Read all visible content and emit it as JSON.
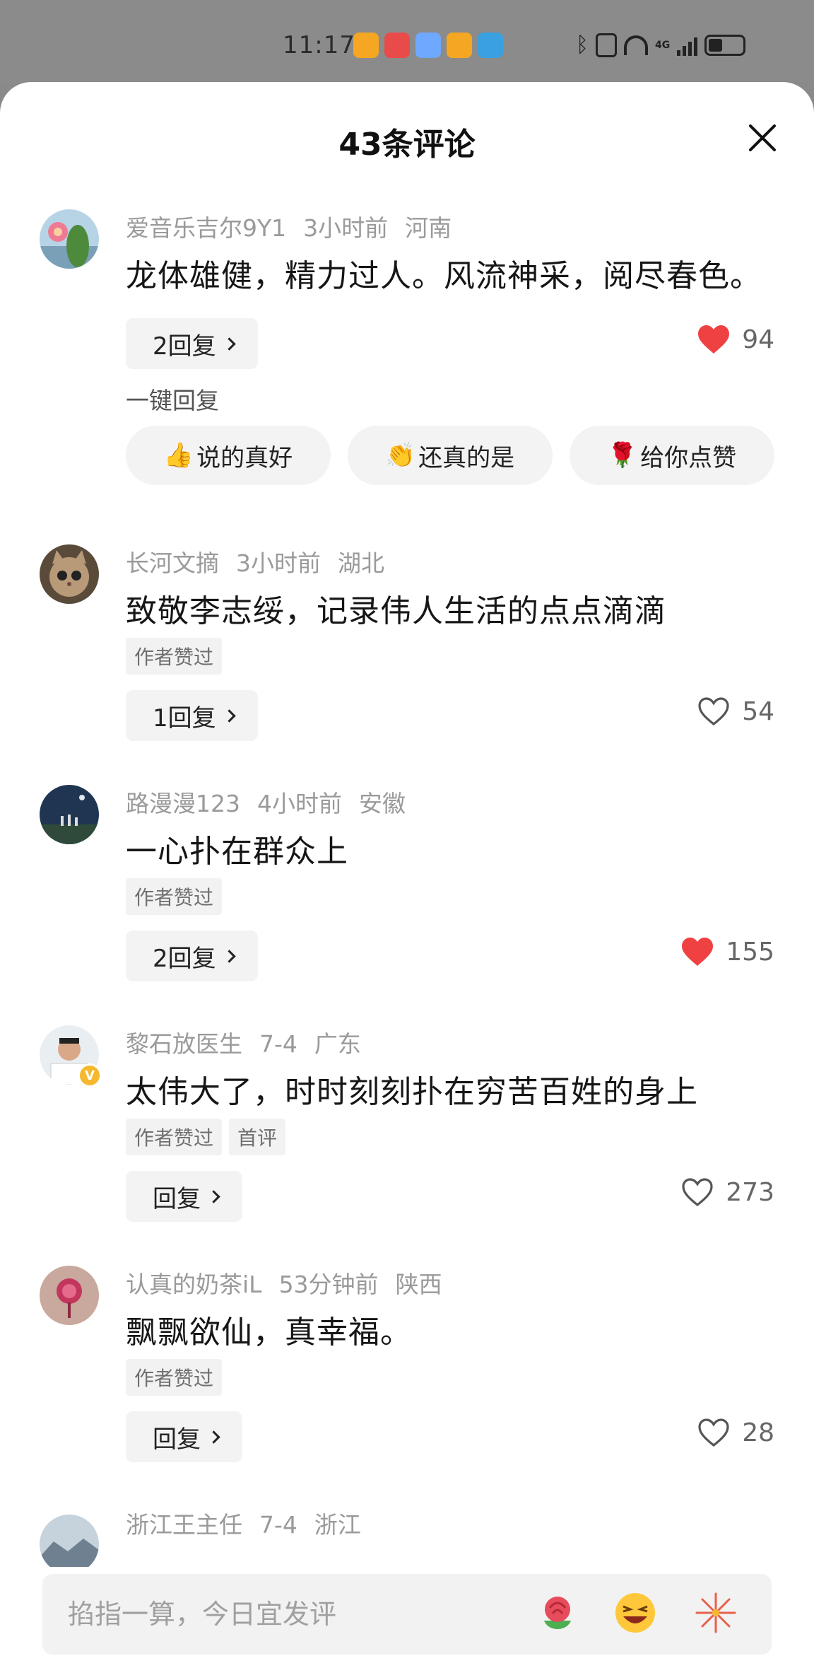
{
  "status_bar": {
    "time": "11:17",
    "app_icons": [
      "weibo-icon",
      "xiaohongshu-icon",
      "app-icon",
      "weibo-icon",
      "weather-icon"
    ],
    "app_icon_colors": [
      "#f5a623",
      "#e94b4b",
      "#6ea8ff",
      "#f5a623",
      "#3aa0e0"
    ],
    "network_label": "4G"
  },
  "sheet": {
    "title": "43条评论",
    "close_icon": "close-icon"
  },
  "comments": [
    {
      "user": "爱音乐吉尔9Y1",
      "time": "3小时前",
      "location": "河南",
      "text": "龙体雄健，精力过人。风流神采，阅尽春色。",
      "tags": [],
      "reply_label": "2回复",
      "likes": "94",
      "liked": true
    },
    {
      "user": "长河文摘",
      "time": "3小时前",
      "location": "湖北",
      "text": "致敬李志绥，记录伟人生活的点点滴滴",
      "tags": [
        "作者赞过"
      ],
      "reply_label": "1回复",
      "likes": "54",
      "liked": false
    },
    {
      "user": "路漫漫123",
      "time": "4小时前",
      "location": "安徽",
      "text": "一心扑在群众上",
      "tags": [
        "作者赞过"
      ],
      "reply_label": "2回复",
      "likes": "155",
      "liked": true
    },
    {
      "user": "黎石放医生",
      "time": "7-4",
      "location": "广东",
      "text": "太伟大了，时时刻刻扑在穷苦百姓的身上",
      "tags": [
        "作者赞过",
        "首评"
      ],
      "reply_label": "回复",
      "likes": "273",
      "liked": false,
      "verified": true
    },
    {
      "user": "认真的奶茶iL",
      "time": "53分钟前",
      "location": "陕西",
      "text": "飘飘欲仙，真幸福。",
      "tags": [
        "作者赞过"
      ],
      "reply_label": "回复",
      "likes": "28",
      "liked": false
    },
    {
      "user": "浙江王主任",
      "time": "7-4",
      "location": "浙江"
    }
  ],
  "quick_reply": {
    "title": "一键回复",
    "options": [
      {
        "emoji": "👍",
        "label": "说的真好"
      },
      {
        "emoji": "👏",
        "label": "还真的是"
      },
      {
        "emoji": "🌹",
        "label": "给你点赞"
      }
    ]
  },
  "input_bar": {
    "placeholder": "掐指一算，今日宜发评",
    "icons": [
      "rose-emoji-icon",
      "laughing-emoji-icon",
      "fireworks-emoji-icon"
    ]
  },
  "colors": {
    "like_active": "#f04142",
    "meta_gray": "#9a9a9a",
    "chip_bg": "#f3f3f3"
  }
}
